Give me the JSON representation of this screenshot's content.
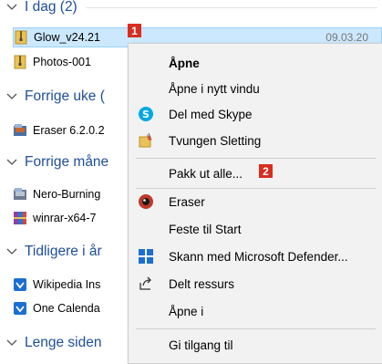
{
  "groups": [
    {
      "label": "I dag (2)"
    },
    {
      "label": "Forrige uke ("
    },
    {
      "label": "Forrige måne"
    },
    {
      "label": "Tidligere i år"
    },
    {
      "label": "Lenge siden"
    }
  ],
  "files": [
    {
      "name": "Glow_v24.21",
      "date": "09.03.20",
      "icon": "zip-folder-icon",
      "selected": true
    },
    {
      "name": "Photos-001",
      "icon": "zip-folder-icon"
    },
    {
      "name": "Eraser 6.2.0.2",
      "icon": "installer-icon"
    },
    {
      "name": "Nero-Burning",
      "icon": "installer-icon"
    },
    {
      "name": "winrar-x64-7",
      "icon": "winrar-icon"
    },
    {
      "name": "Wikipedia Ins",
      "icon": "store-app-icon"
    },
    {
      "name": "One Calenda",
      "icon": "store-app-icon"
    }
  ],
  "markers": {
    "first": "1",
    "second": "2"
  },
  "context_menu": {
    "items": [
      {
        "label": "Åpne",
        "bold": true,
        "icon": ""
      },
      {
        "label": "Åpne i nytt vindu",
        "icon": ""
      },
      {
        "label": "Del med Skype",
        "icon": "skype-icon"
      },
      {
        "label": "Tvungen Sletting",
        "icon": "force-delete-icon"
      },
      {
        "label": "Pakk ut alle...",
        "icon": ""
      },
      {
        "label": "Eraser",
        "icon": "eraser-icon"
      },
      {
        "label": "Feste til Start",
        "icon": ""
      },
      {
        "label": "Skann med Microsoft Defender...",
        "icon": "defender-icon"
      },
      {
        "label": "Delt ressurs",
        "icon": "share-icon"
      },
      {
        "label": "Åpne i",
        "icon": ""
      },
      {
        "label": "Gi tilgang til",
        "icon": ""
      }
    ]
  },
  "colors": {
    "group_text": "#1f4e9a",
    "selection": "#cce8ff",
    "marker": "#d92d20",
    "menu_bg": "#f2f2f2"
  }
}
